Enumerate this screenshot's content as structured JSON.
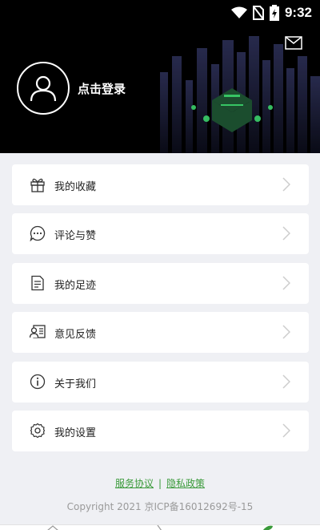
{
  "status_bar": {
    "time": "9:32"
  },
  "header": {
    "login_label": "点击登录"
  },
  "menu": {
    "items": [
      {
        "label": "我的收藏",
        "icon": "gift-icon"
      },
      {
        "label": "评论与赞",
        "icon": "comment-icon"
      },
      {
        "label": "我的足迹",
        "icon": "document-icon"
      },
      {
        "label": "意见反馈",
        "icon": "feedback-icon"
      },
      {
        "label": "关于我们",
        "icon": "info-icon"
      },
      {
        "label": "我的设置",
        "icon": "gear-icon"
      }
    ]
  },
  "footer": {
    "service_link": "服务协议",
    "separator": "|",
    "privacy_link": "隐私政策",
    "copyright": "Copyright 2021 京ICP备16012692号-15"
  },
  "colors": {
    "accent": "#3a9a3a",
    "header_bg": "#000000",
    "page_bg": "#eff0f4"
  }
}
